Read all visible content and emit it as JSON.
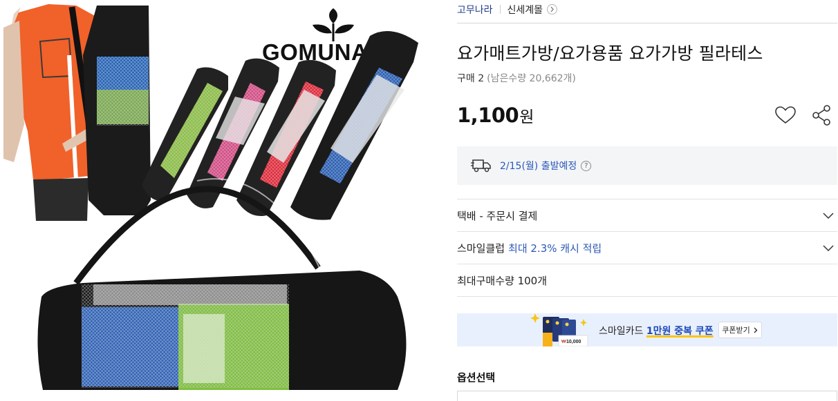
{
  "image": {
    "brand_logo_text": "GOMUNARA",
    "logo_icon": "leaf-sprout-icon"
  },
  "seller": {
    "name": "고무나라",
    "store": "신세계몰",
    "store_icon": "chevron-right-icon"
  },
  "product": {
    "title": "요가매트가방/요가용품 요가가방 필라테스",
    "purchase_label": "구매 2",
    "remaining": "(남은수량 20,662개)",
    "price": "1,100",
    "price_unit": "원"
  },
  "actions": {
    "wish_icon": "heart-icon",
    "share_icon": "share-icon"
  },
  "shipping": {
    "icon": "delivery-truck-icon",
    "text": "2/15(월) 출발예정",
    "help": "?"
  },
  "rows": {
    "delivery": "택배 - 주문시 결제",
    "smile_club_label": "스마일클럽",
    "smile_club_benefit": "최대 2.3% 캐시 적립",
    "max_qty": "최대구매수량 100개"
  },
  "coupon": {
    "text_prefix": "스마일카드",
    "text_highlight": "1만원 중복 쿠폰",
    "button": "쿠폰받기",
    "card_amount": "10,000",
    "colors": {
      "banner_bg": "#e9f0fd",
      "highlight": "#1c49b8",
      "underline": "#ffc400"
    }
  },
  "option": {
    "title": "옵션선택"
  },
  "colors": {
    "link_blue": "#2b58b8",
    "ship_box_bg": "#f4f5f7"
  }
}
